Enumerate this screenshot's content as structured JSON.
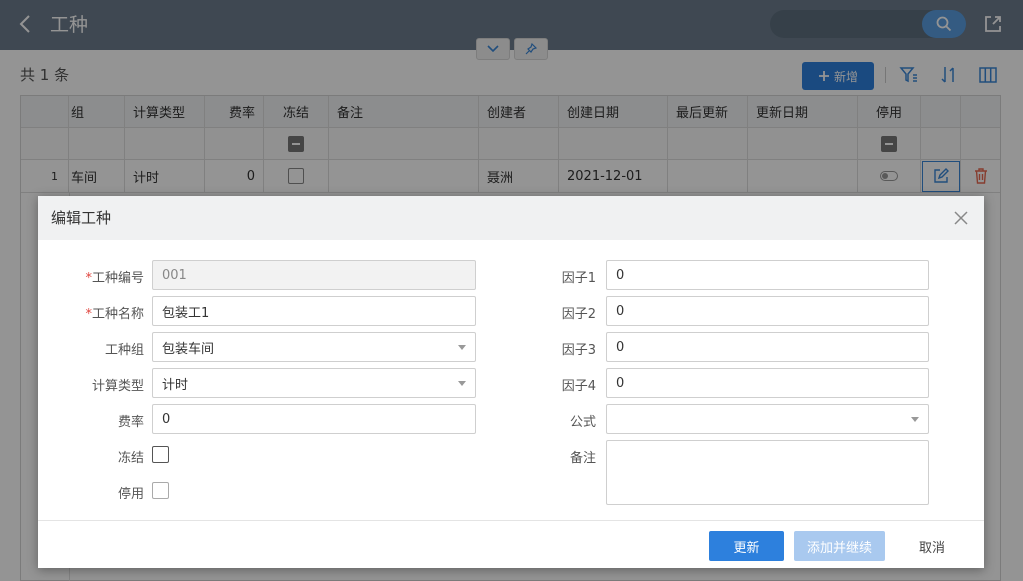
{
  "header": {
    "title": "工种"
  },
  "page": {
    "count_text": "共 1 条",
    "add_label": "新增"
  },
  "grid": {
    "columns": [
      "组",
      "计算类型",
      "费率",
      "冻结",
      "备注",
      "创建者",
      "创建日期",
      "最后更新",
      "更新日期",
      "停用"
    ],
    "rows": [
      {
        "num": "1",
        "group": "车间",
        "calc_type": "计时",
        "rate": "0",
        "creator": "聂洲",
        "created": "2021-12-01"
      }
    ]
  },
  "modal": {
    "title": "编辑工种",
    "labels": {
      "code": "工种编号",
      "name": "工种名称",
      "group": "工种组",
      "calc_type": "计算类型",
      "rate": "费率",
      "frozen": "冻结",
      "disabled": "停用",
      "f1": "因子1",
      "f2": "因子2",
      "f3": "因子3",
      "f4": "因子4",
      "formula": "公式",
      "note": "备注"
    },
    "required_mark": "*",
    "values": {
      "code": "001",
      "name": "包装工1",
      "group": "包装车间",
      "calc_type": "计时",
      "rate": "0",
      "f1": "0",
      "f2": "0",
      "f3": "0",
      "f4": "0",
      "formula": "",
      "note": ""
    },
    "buttons": {
      "update": "更新",
      "add_continue": "添加并继续",
      "cancel": "取消"
    }
  },
  "colors": {
    "header_bg": "#6d7d8d",
    "primary": "#2d80dd",
    "delete": "#e86a52",
    "required": "#e0443e"
  }
}
